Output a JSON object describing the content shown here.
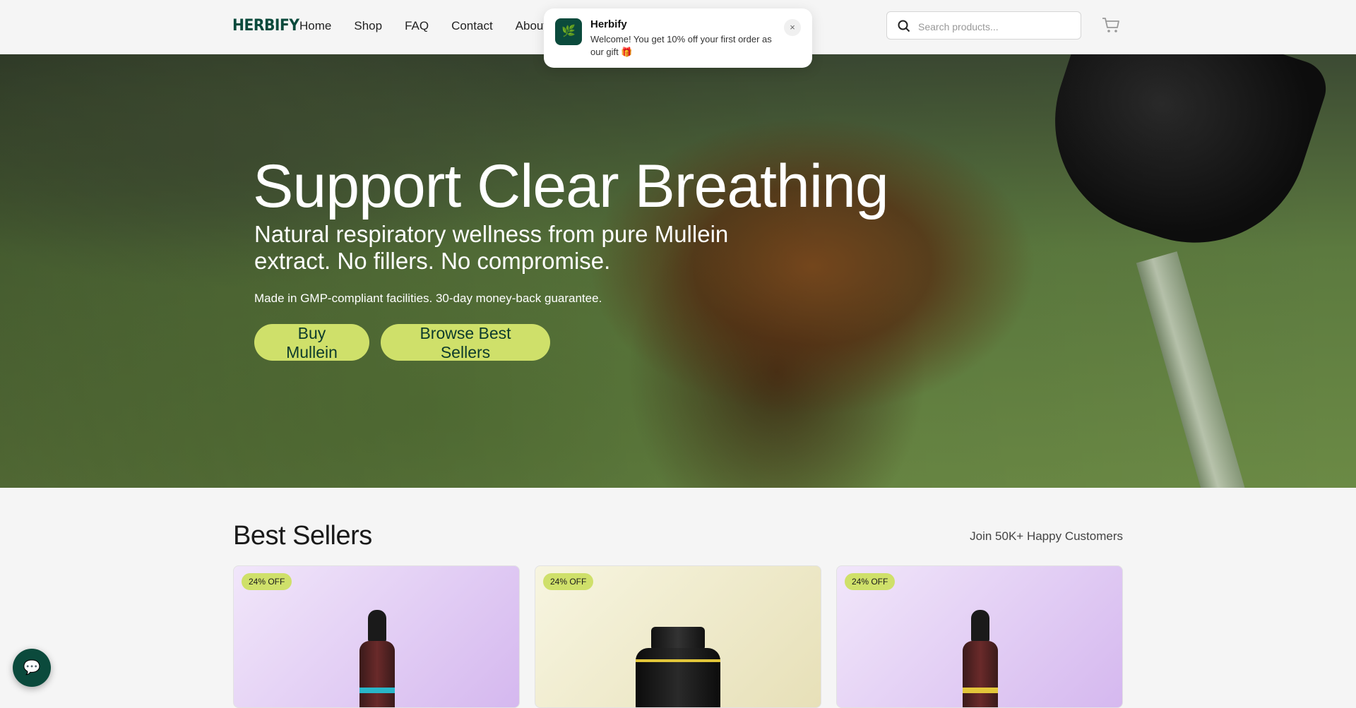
{
  "header": {
    "logo": "HERBIFY",
    "nav": [
      "Home",
      "Shop",
      "FAQ",
      "Contact",
      "About U"
    ],
    "search_placeholder": "Search products...",
    "icons": {
      "search": "search-icon",
      "cart": "cart-icon"
    }
  },
  "toast": {
    "title": "Herbify",
    "message": "Welcome! You get 10% off your first order as our gift 🎁",
    "close": "×",
    "icon": "brand-icon"
  },
  "hero": {
    "title": "Support Clear Breathing",
    "subtitle": "Natural respiratory wellness from pure Mullein extract. No fillers. No compromise.",
    "guarantee": "Made in GMP-compliant facilities. 30-day money-back guarantee.",
    "buy_label": "Buy Mullein",
    "browse_label": "Browse Best Sellers"
  },
  "best_sellers": {
    "title": "Best Sellers",
    "join": "Join 50K+ Happy Customers",
    "products": [
      {
        "badge": "24% OFF",
        "band_color": "#29b6c8"
      },
      {
        "badge": "24% OFF",
        "band_color": "#e2c63a"
      },
      {
        "badge": "24% OFF",
        "band_color": "#e2c63a"
      }
    ]
  },
  "chat": {
    "icon": "chat-icon"
  },
  "colors": {
    "brand": "#0b4a3c",
    "accent": "#cfe06a"
  }
}
